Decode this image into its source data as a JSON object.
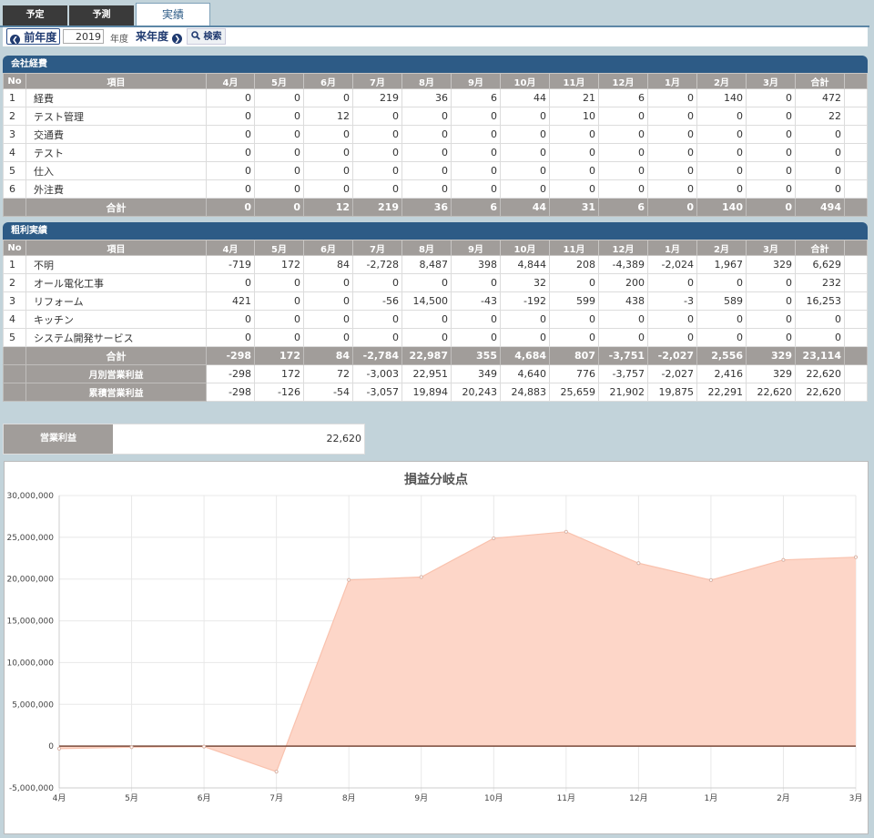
{
  "tabs": [
    {
      "label": "予定"
    },
    {
      "label": "予測"
    },
    {
      "label": "実績"
    }
  ],
  "toolbar": {
    "prev_label": "前年度",
    "year": "2019",
    "year_unit": "年度",
    "next_label": "来年度",
    "search_label": "検索"
  },
  "months": [
    "4月",
    "5月",
    "6月",
    "7月",
    "8月",
    "9月",
    "10月",
    "11月",
    "12月",
    "1月",
    "2月",
    "3月"
  ],
  "expenses": {
    "title": "会社経費",
    "columns": [
      "No",
      "項目",
      "4月",
      "5月",
      "6月",
      "7月",
      "8月",
      "9月",
      "10月",
      "11月",
      "12月",
      "1月",
      "2月",
      "3月",
      "合計"
    ],
    "rows": [
      [
        "1",
        "経費",
        "0",
        "0",
        "0",
        "219",
        "36",
        "6",
        "44",
        "21",
        "6",
        "0",
        "140",
        "0",
        "472"
      ],
      [
        "2",
        "テスト管理",
        "0",
        "0",
        "12",
        "0",
        "0",
        "0",
        "0",
        "10",
        "0",
        "0",
        "0",
        "0",
        "22"
      ],
      [
        "3",
        "交通費",
        "0",
        "0",
        "0",
        "0",
        "0",
        "0",
        "0",
        "0",
        "0",
        "0",
        "0",
        "0",
        "0"
      ],
      [
        "4",
        "テスト",
        "0",
        "0",
        "0",
        "0",
        "0",
        "0",
        "0",
        "0",
        "0",
        "0",
        "0",
        "0",
        "0"
      ],
      [
        "5",
        "仕入",
        "0",
        "0",
        "0",
        "0",
        "0",
        "0",
        "0",
        "0",
        "0",
        "0",
        "0",
        "0",
        "0"
      ],
      [
        "6",
        "外注費",
        "0",
        "0",
        "0",
        "0",
        "0",
        "0",
        "0",
        "0",
        "0",
        "0",
        "0",
        "0",
        "0"
      ]
    ],
    "total": {
      "label": "合計",
      "values": [
        "0",
        "0",
        "12",
        "219",
        "36",
        "6",
        "44",
        "31",
        "6",
        "0",
        "140",
        "0",
        "494"
      ]
    }
  },
  "gross_profit": {
    "title": "粗利実績",
    "columns": [
      "No",
      "項目",
      "4月",
      "5月",
      "6月",
      "7月",
      "8月",
      "9月",
      "10月",
      "11月",
      "12月",
      "1月",
      "2月",
      "3月",
      "合計"
    ],
    "rows": [
      [
        "1",
        "不明",
        "-719",
        "172",
        "84",
        "-2,728",
        "8,487",
        "398",
        "4,844",
        "208",
        "-4,389",
        "-2,024",
        "1,967",
        "329",
        "6,629"
      ],
      [
        "2",
        "オール電化工事",
        "0",
        "0",
        "0",
        "0",
        "0",
        "0",
        "32",
        "0",
        "200",
        "0",
        "0",
        "0",
        "232"
      ],
      [
        "3",
        "リフォーム",
        "421",
        "0",
        "0",
        "-56",
        "14,500",
        "-43",
        "-192",
        "599",
        "438",
        "-3",
        "589",
        "0",
        "16,253"
      ],
      [
        "4",
        "キッチン",
        "0",
        "0",
        "0",
        "0",
        "0",
        "0",
        "0",
        "0",
        "0",
        "0",
        "0",
        "0",
        "0"
      ],
      [
        "5",
        "システム開発サービス",
        "0",
        "0",
        "0",
        "0",
        "0",
        "0",
        "0",
        "0",
        "0",
        "0",
        "0",
        "0",
        "0"
      ]
    ],
    "total": {
      "label": "合計",
      "values": [
        "-298",
        "172",
        "84",
        "-2,784",
        "22,987",
        "355",
        "4,684",
        "807",
        "-3,751",
        "-2,027",
        "2,556",
        "329",
        "23,114"
      ]
    },
    "monthly_op": {
      "label": "月別営業利益",
      "values": [
        "-298",
        "172",
        "72",
        "-3,003",
        "22,951",
        "349",
        "4,640",
        "776",
        "-3,757",
        "-2,027",
        "2,416",
        "329",
        "22,620"
      ]
    },
    "cumulative_op": {
      "label": "累積営業利益",
      "values": [
        "-298",
        "-126",
        "-54",
        "-3,057",
        "19,894",
        "20,243",
        "24,883",
        "25,659",
        "21,902",
        "19,875",
        "22,291",
        "22,620",
        "22,620"
      ]
    }
  },
  "operating_profit": {
    "label": "営業利益",
    "value": "22,620"
  },
  "chart_data": {
    "type": "area",
    "title": "損益分岐点",
    "x": [
      "4月",
      "5月",
      "6月",
      "7月",
      "8月",
      "9月",
      "10月",
      "11月",
      "12月",
      "1月",
      "2月",
      "3月"
    ],
    "ylim": [
      -5000000,
      30000000
    ],
    "yticks": [
      -5000000,
      0,
      5000000,
      10000000,
      15000000,
      20000000,
      25000000,
      30000000
    ],
    "ytick_labels": [
      "-5,000,000",
      "0",
      "5,000,000",
      "10,000,000",
      "15,000,000",
      "20,000,000",
      "25,000,000",
      "30,000,000"
    ],
    "grid": true,
    "series": [
      {
        "values": [
          -298000,
          -126000,
          -54000,
          -3057000,
          19894000,
          20243000,
          24883000,
          25659000,
          21902000,
          19875000,
          22291000,
          22620000
        ],
        "color": "#fdd6c8",
        "line_color": "#f9c2ae"
      }
    ],
    "baseline_color": "#7a4a3a"
  }
}
